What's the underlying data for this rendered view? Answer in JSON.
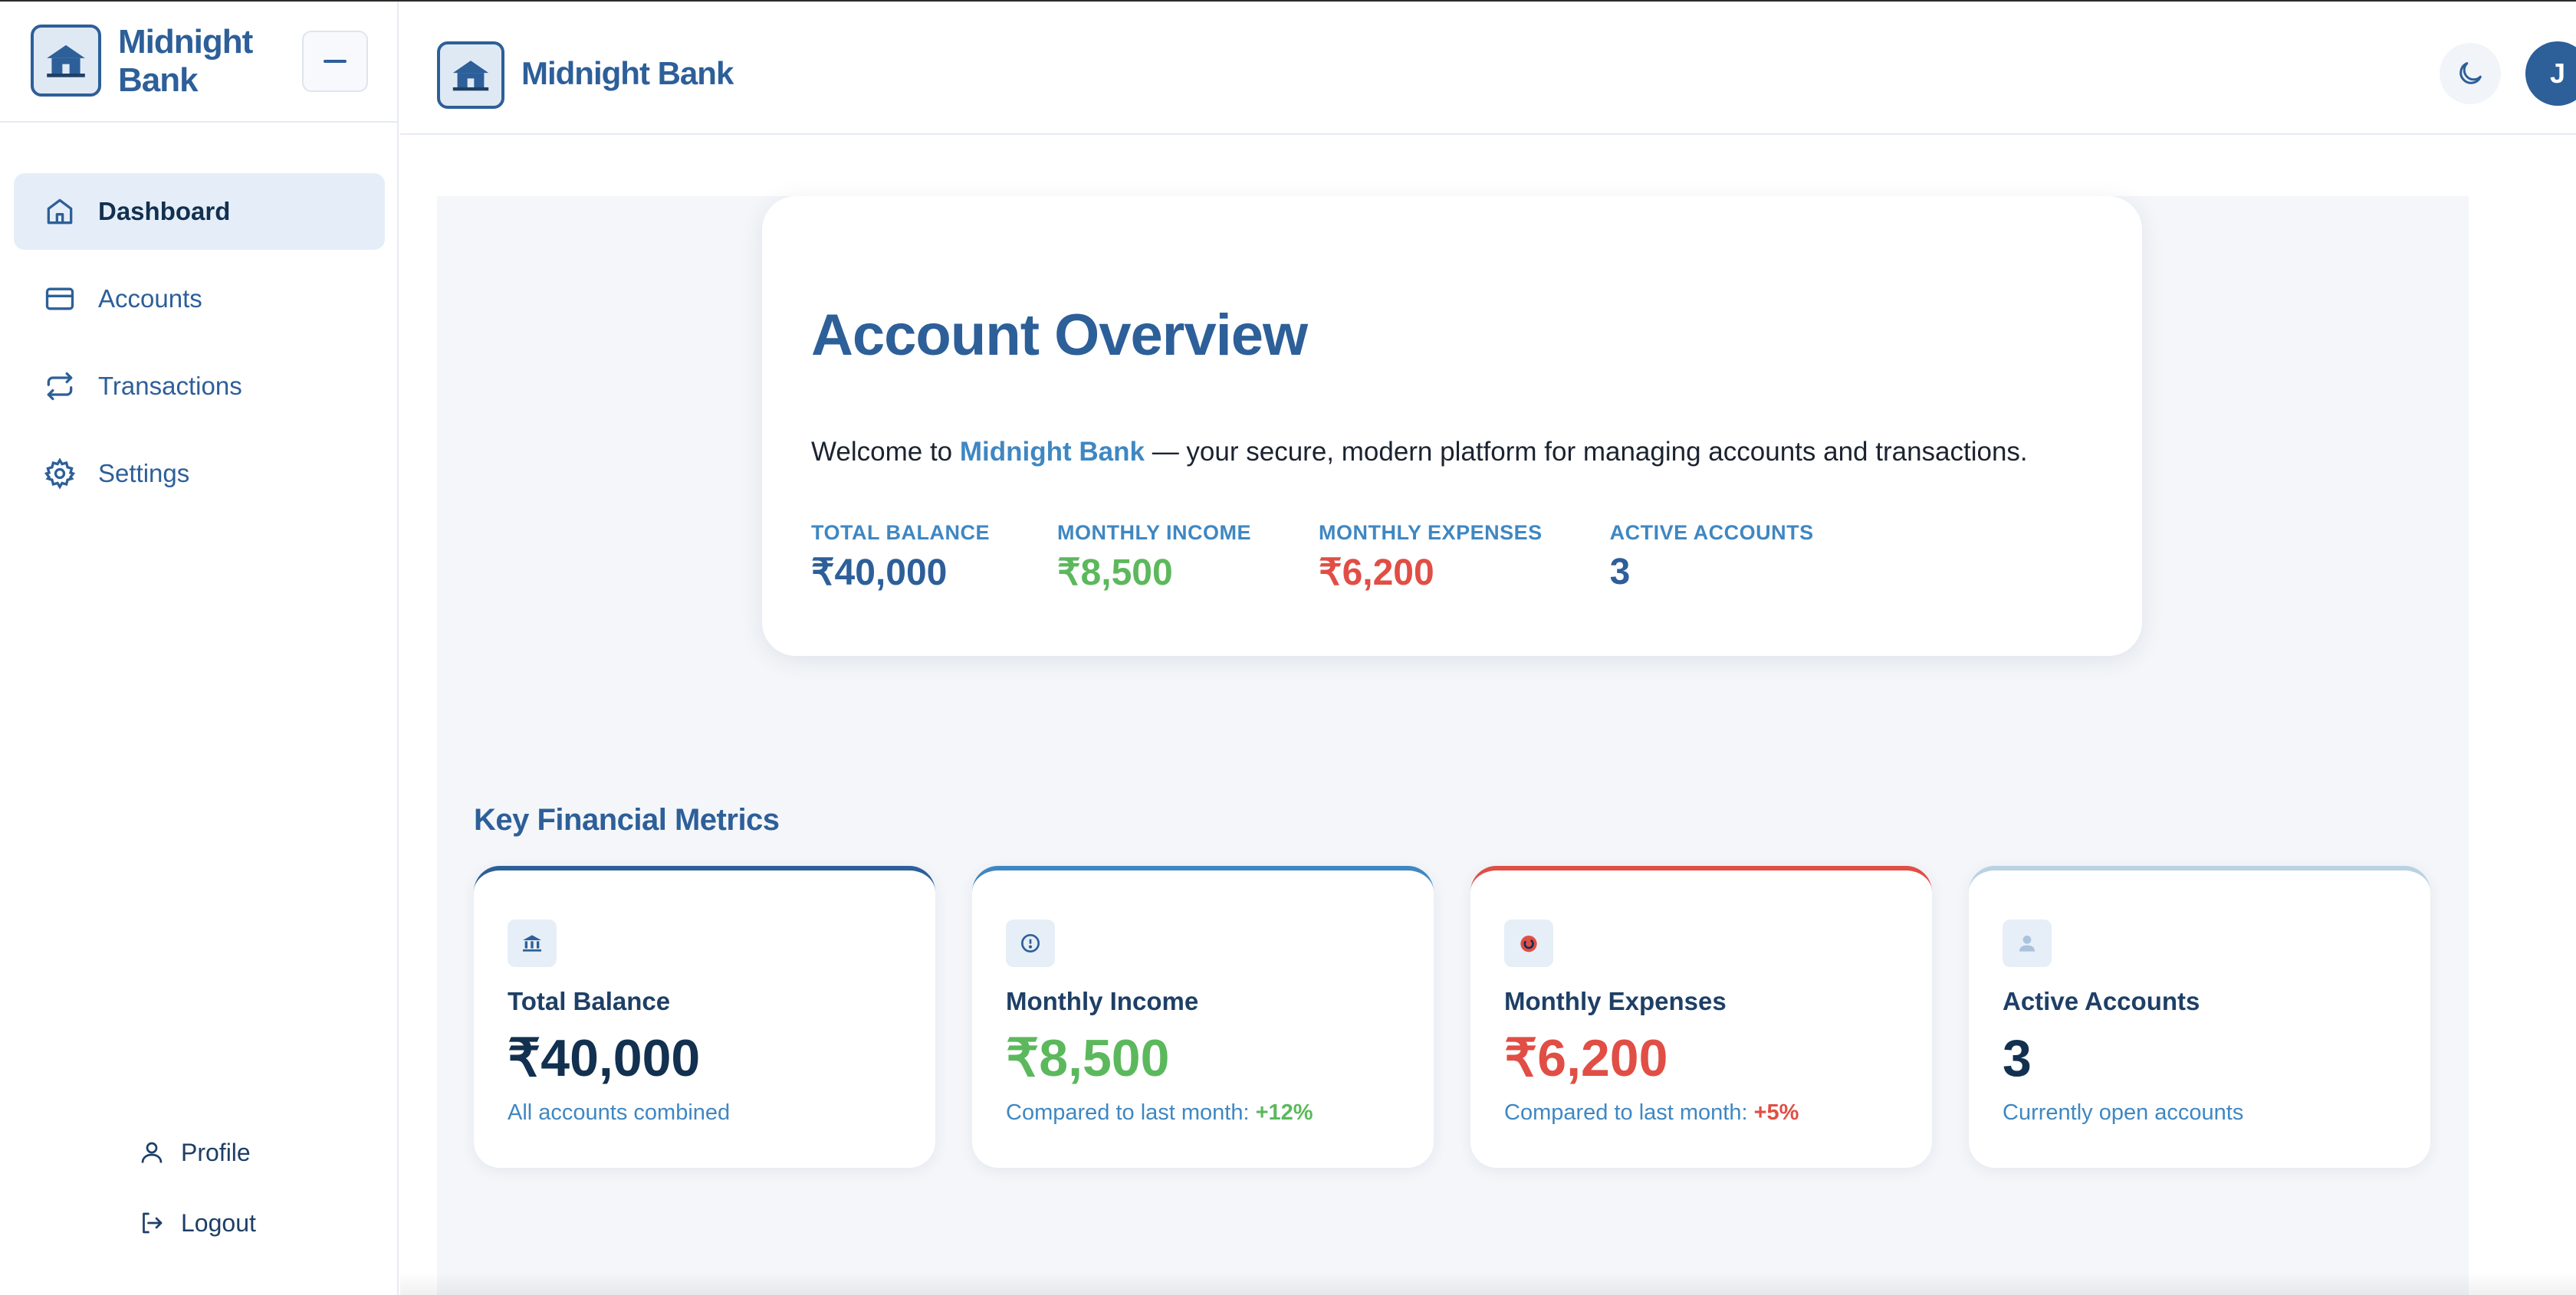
{
  "colors": {
    "brand": "#2d5f99",
    "accent": "#3f87c2",
    "positive": "#5cb85c",
    "negative": "#e04e45",
    "dark": "#12304f",
    "muted_top": "#b9d1e3"
  },
  "sidebar": {
    "brand_line1": "Midnight",
    "brand_line2": "Bank",
    "logo_icon": "bank-house-icon",
    "collapse_icon": "minus-icon",
    "items": [
      {
        "label": "Dashboard",
        "icon": "home-icon",
        "active": true
      },
      {
        "label": "Accounts",
        "icon": "credit-card-icon",
        "active": false
      },
      {
        "label": "Transactions",
        "icon": "repeat-arrows-icon",
        "active": false
      },
      {
        "label": "Settings",
        "icon": "gear-icon",
        "active": false
      }
    ],
    "bottom": [
      {
        "label": "Profile",
        "icon": "user-icon"
      },
      {
        "label": "Logout",
        "icon": "logout-icon"
      }
    ]
  },
  "header": {
    "title": "Midnight Bank",
    "theme_icon": "moon-icon",
    "avatar_initial": "J"
  },
  "overview": {
    "title": "Account Overview",
    "welcome_prefix": "Welcome to ",
    "welcome_brand": "Midnight Bank",
    "welcome_suffix": " — your secure, modern platform for managing accounts and transactions.",
    "stats": [
      {
        "label": "TOTAL BALANCE",
        "value": "₹40,000",
        "tone": "brand"
      },
      {
        "label": "MONTHLY INCOME",
        "value": "₹8,500",
        "tone": "positive"
      },
      {
        "label": "MONTHLY EXPENSES",
        "value": "₹6,200",
        "tone": "negative"
      },
      {
        "label": "ACTIVE ACCOUNTS",
        "value": "3",
        "tone": "brand"
      }
    ]
  },
  "metrics": {
    "section_title": "Key Financial Metrics",
    "cards": [
      {
        "label": "Total Balance",
        "value": "₹40,000",
        "note": "All accounts combined",
        "note_value": "",
        "icon": "bank-icon",
        "tone": "dark"
      },
      {
        "label": "Monthly Income",
        "value": "₹8,500",
        "note": "Compared to last month: ",
        "note_value": "+12%",
        "icon": "clock-icon",
        "tone": "positive"
      },
      {
        "label": "Monthly Expenses",
        "value": "₹6,200",
        "note": "Compared to last month: ",
        "note_value": "+5%",
        "icon": "expense-circle-icon",
        "tone": "negative"
      },
      {
        "label": "Active Accounts",
        "value": "3",
        "note": "Currently open accounts",
        "note_value": "",
        "icon": "user-icon",
        "tone": "dark"
      }
    ]
  }
}
